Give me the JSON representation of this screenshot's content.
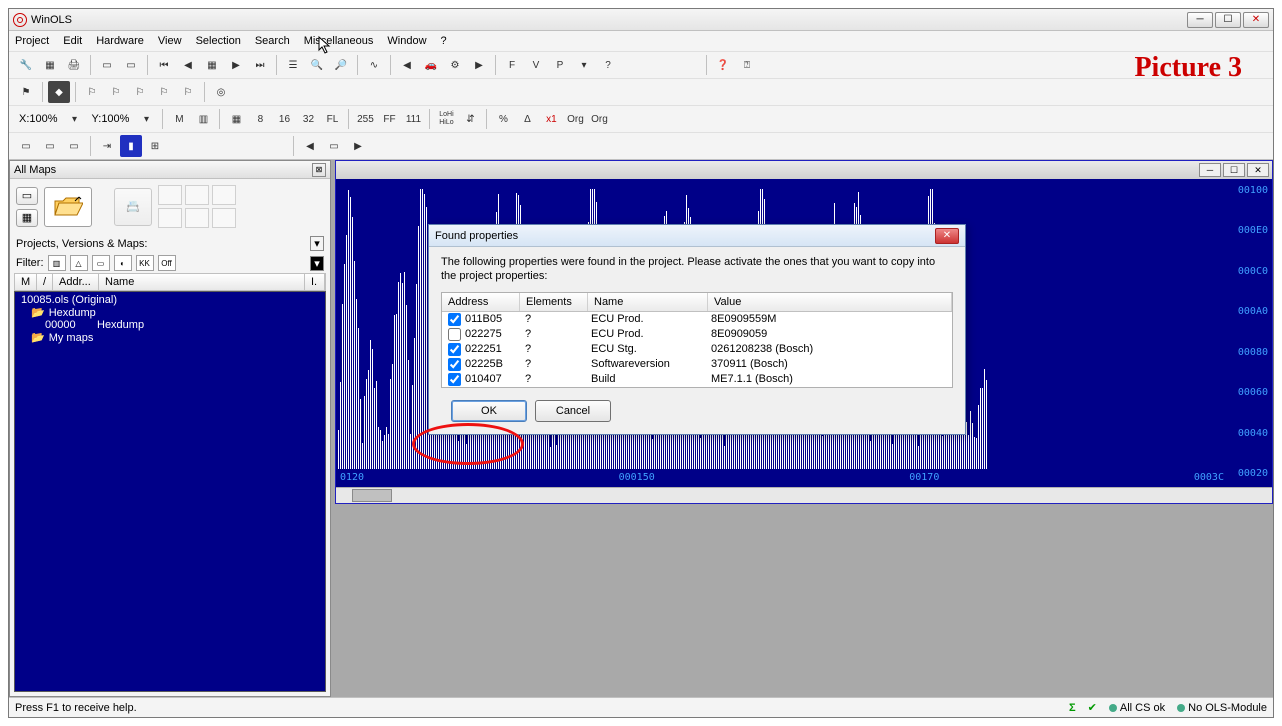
{
  "window": {
    "title": "WinOLS"
  },
  "menu": [
    "Project",
    "Edit",
    "Hardware",
    "View",
    "Selection",
    "Search",
    "Miscellaneous",
    "Window",
    "?"
  ],
  "toolbar": {
    "x_zoom": "X:100%",
    "y_zoom": "Y:100%",
    "pic_label": "Picture 3"
  },
  "allmaps": {
    "title": "All Maps",
    "pvm_label": "Projects, Versions & Maps:",
    "filter_label": "Filter:",
    "filter_off": "Off",
    "columns": {
      "m": "M",
      "slash": "/",
      "addr": "Addr...",
      "name": "Name",
      "i": "I."
    },
    "tree": {
      "root": "10085.ols (Original)",
      "hexdump_folder": "Hexdump",
      "hex_addr": "00000",
      "hex_name": "Hexdump",
      "mymaps_folder": "My maps"
    }
  },
  "hex": {
    "right_labels": [
      "00100",
      "000E0",
      "000C0",
      "000A0",
      "00080",
      "00060",
      "00040",
      "00020"
    ],
    "bottom_labels": [
      "0120",
      "000150",
      "00170",
      "0003C"
    ]
  },
  "dialog": {
    "title": "Found properties",
    "message": "The following properties were found in the project. Please activate the ones that you want to copy into the project properties:",
    "columns": {
      "addr": "Address",
      "elem": "Elements",
      "name": "Name",
      "val": "Value"
    },
    "rows": [
      {
        "checked": true,
        "addr": "011B05",
        "elem": "?",
        "name": "ECU Prod.",
        "val": "8E0909559M"
      },
      {
        "checked": false,
        "addr": "022275",
        "elem": "?",
        "name": "ECU Prod.",
        "val": "8E0909059"
      },
      {
        "checked": true,
        "addr": "022251",
        "elem": "?",
        "name": "ECU Stg.",
        "val": "0261208238 (Bosch)"
      },
      {
        "checked": true,
        "addr": "02225B",
        "elem": "?",
        "name": "Softwareversion",
        "val": "370911 (Bosch)"
      },
      {
        "checked": true,
        "addr": "010407",
        "elem": "?",
        "name": "Build",
        "val": "ME7.1.1 (Bosch)"
      }
    ],
    "ok": "OK",
    "cancel": "Cancel"
  },
  "status": {
    "help": "Press F1 to receive help.",
    "cs": "All CS ok",
    "module": "No OLS-Module"
  }
}
